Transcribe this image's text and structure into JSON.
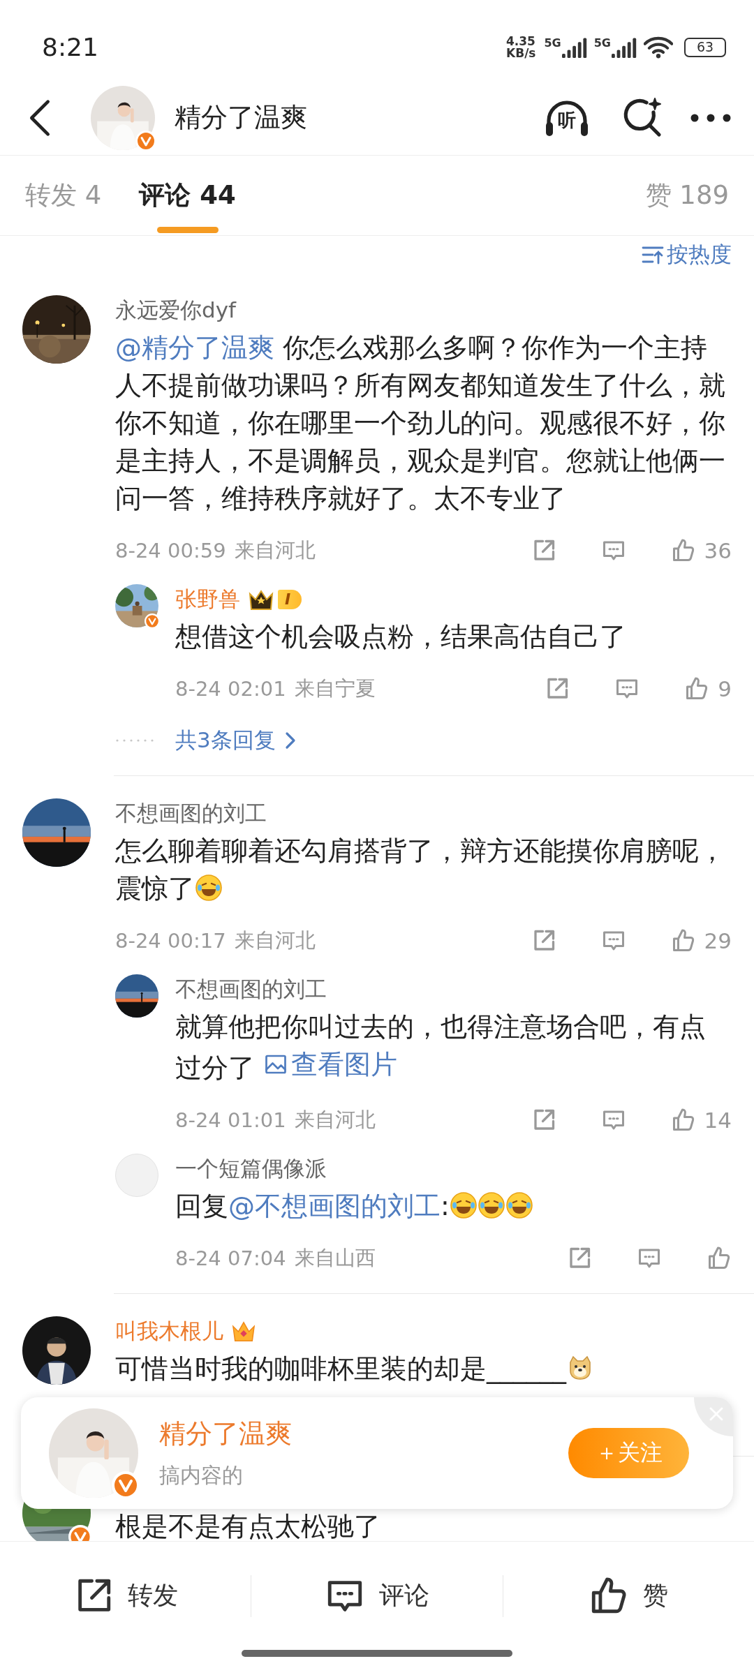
{
  "status_bar": {
    "time": "8:21",
    "net_speed": "4.35",
    "net_unit": "KB/s",
    "networks": [
      "5G",
      "5G"
    ],
    "battery": "63"
  },
  "header": {
    "name": "精分了温爽",
    "verified": true,
    "listen_label": "听"
  },
  "tabs": [
    {
      "label": "转发 4",
      "selected": false
    },
    {
      "label": "评论 44",
      "selected": true
    },
    {
      "label": "赞 189",
      "selected": false
    }
  ],
  "sort": {
    "label": "按热度"
  },
  "comments": [
    {
      "author": "永远爱你dyf",
      "vip": false,
      "verified": false,
      "avatar": {
        "kind": "picture"
      },
      "segments": [
        {
          "kind": "mention",
          "text": "@精分了温爽"
        },
        {
          "kind": "text",
          "text": " 你怎么戏那么多啊？你作为一个主持人不提前做功课吗？所有网友都知道发生了什么，就你不知道，你在哪里一个劲儿的问。观感很不好，你是主持人，不是调解员，观众是判官。您就让他俩一问一答，维持秩序就好了。太不专业了"
        }
      ],
      "time": "8-24 00:59",
      "location": "来自河北",
      "likes": "36",
      "replies": [
        {
          "author": "张野兽",
          "vip": true,
          "verified": true,
          "badge": {
            "kind": "level",
            "text": "I"
          },
          "avatar": {
            "kind": "picture"
          },
          "segments": [
            {
              "kind": "text",
              "text": "想借这个机会吸点粉，结果高估自己了"
            }
          ],
          "time": "8-24 02:01",
          "location": "来自宁夏",
          "likes": "9"
        }
      ],
      "more_replies": "共3条回复"
    },
    {
      "author": "不想画图的刘工",
      "vip": false,
      "verified": false,
      "avatar": {
        "kind": "picture"
      },
      "segments": [
        {
          "kind": "text",
          "text": "怎么聊着聊着还勾肩搭背了，辩方还能摸你肩膀呢，震惊了"
        },
        {
          "kind": "laughemoji"
        }
      ],
      "time": "8-24 00:17",
      "location": "来自河北",
      "likes": "29",
      "replies": [
        {
          "author": "不想画图的刘工",
          "vip": false,
          "verified": false,
          "avatar": {
            "kind": "picture"
          },
          "segments": [
            {
              "kind": "text",
              "text": "就算他把你叫过去的，也得注意场合吧，有点过分了 "
            },
            {
              "kind": "link",
              "text": "查看图片"
            }
          ],
          "time": "8-24 01:01",
          "location": "来自河北",
          "likes": "14"
        },
        {
          "author": "一个短篇偶像派",
          "vip": false,
          "verified": false,
          "avatar": {
            "kind": "default"
          },
          "segments": [
            {
              "kind": "text",
              "text": "回复"
            },
            {
              "kind": "mention",
              "text": "@不想画图的刘工"
            },
            {
              "kind": "text",
              "text": ":"
            },
            {
              "kind": "laughemoji"
            },
            {
              "kind": "laughemoji"
            },
            {
              "kind": "laughemoji"
            }
          ],
          "time": "8-24 07:04",
          "location": "来自山西"
        }
      ]
    },
    {
      "author": "叫我木根儿",
      "vip": true,
      "verified": false,
      "badge": {
        "kind": "crown"
      },
      "avatar": {
        "kind": "picture"
      },
      "segments": [
        {
          "kind": "text",
          "text": "可惜当时我的咖啡杯里装的却是______"
        },
        {
          "kind": "dogemoji"
        }
      ]
    },
    {
      "verified": true,
      "avatar": {
        "kind": "picture"
      },
      "segments": [
        {
          "kind": "text",
          "text": "根是不是有点太松驰了"
        }
      ]
    }
  ],
  "follow_card": {
    "name": "精分了温爽",
    "subtitle": "搞内容的",
    "verified": true,
    "button": "＋关注"
  },
  "bottom_bar": [
    {
      "kind": "share",
      "label": "转发"
    },
    {
      "kind": "comment",
      "label": "评论"
    },
    {
      "kind": "like",
      "label": "赞"
    }
  ]
}
